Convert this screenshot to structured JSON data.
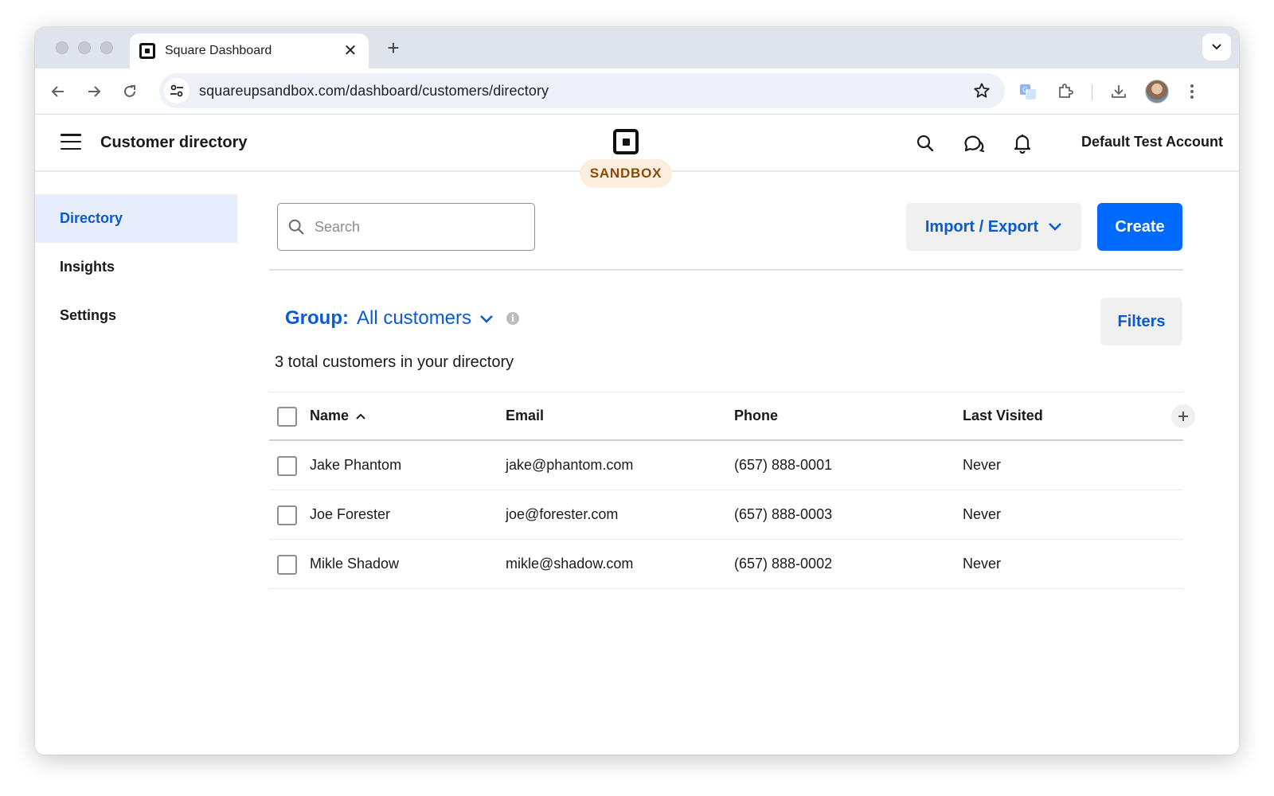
{
  "browser": {
    "tab_title": "Square Dashboard",
    "url": "squareupsandbox.com/dashboard/customers/directory",
    "icons": [
      "back-icon",
      "forward-icon",
      "reload-icon",
      "site-info-icon",
      "star-icon",
      "translate-icon",
      "extensions-icon",
      "download-icon",
      "profile-avatar",
      "more-icon",
      "tab-search-icon"
    ]
  },
  "header": {
    "title": "Customer directory",
    "environment_badge": "SANDBOX",
    "account_name": "Default Test Account",
    "icons": [
      "menu-icon",
      "square-logo",
      "search-icon",
      "chat-icon",
      "bell-icon"
    ]
  },
  "sidebar": {
    "items": [
      {
        "label": "Directory",
        "active": true
      },
      {
        "label": "Insights",
        "active": false
      },
      {
        "label": "Settings",
        "active": false
      }
    ]
  },
  "toolbar": {
    "search_placeholder": "Search",
    "import_export_label": "Import / Export",
    "create_label": "Create"
  },
  "group": {
    "label": "Group:",
    "value": "All customers"
  },
  "filters_label": "Filters",
  "total_text": "3 total customers in your directory",
  "table": {
    "columns": [
      "Name",
      "Email",
      "Phone",
      "Last Visited"
    ],
    "rows": [
      {
        "name": "Jake Phantom",
        "email": "jake@phantom.com",
        "phone": "(657) 888-0001",
        "last_visited": "Never"
      },
      {
        "name": "Joe Forester",
        "email": "joe@forester.com",
        "phone": "(657) 888-0003",
        "last_visited": "Never"
      },
      {
        "name": "Mikle Shadow",
        "email": "mikle@shadow.com",
        "phone": "(657) 888-0002",
        "last_visited": "Never"
      }
    ]
  },
  "colors": {
    "accent_blue": "#006aff",
    "link_blue": "#0a5ad6",
    "sandbox_bg": "#fbeede",
    "sandbox_text": "#8a4b0a",
    "active_nav_bg": "#e6eefd"
  }
}
